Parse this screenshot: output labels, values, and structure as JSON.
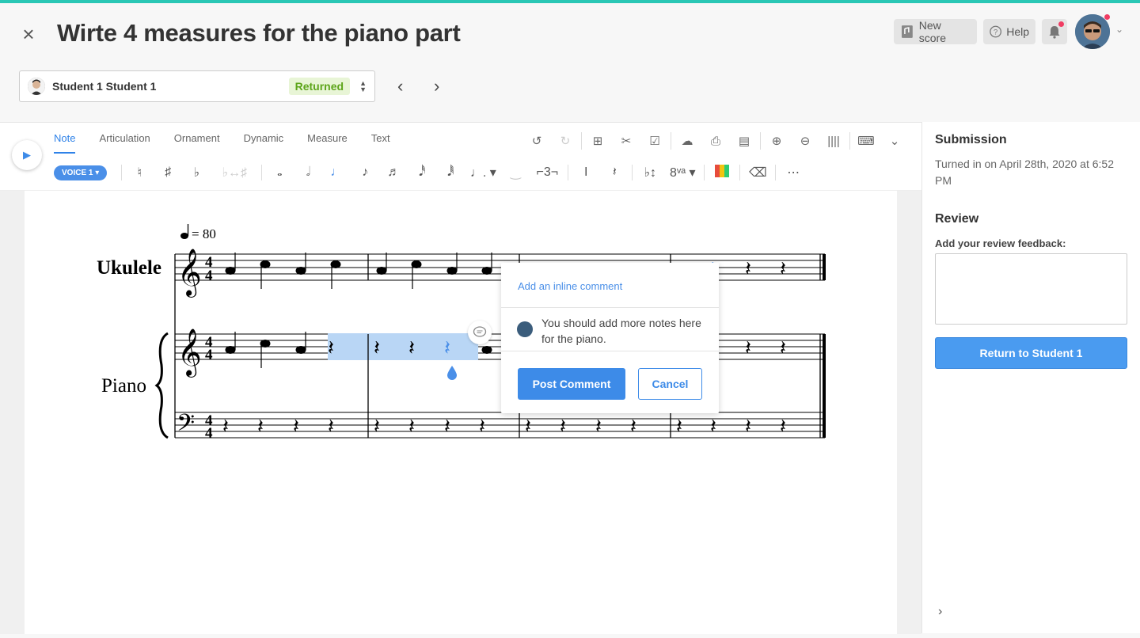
{
  "header": {
    "title": "Wirte 4 measures for the piano part",
    "new_score_label": "New score",
    "help_label": "Help"
  },
  "student": {
    "name": "Student 1 Student 1",
    "status": "Returned"
  },
  "toolbar": {
    "tabs": [
      "Note",
      "Articulation",
      "Ornament",
      "Dynamic",
      "Measure",
      "Text"
    ],
    "active_tab": "Note",
    "voice_label": "VOICE 1"
  },
  "score": {
    "tempo": "= 80",
    "instruments": [
      "Ukulele",
      "Piano"
    ]
  },
  "comment": {
    "add_label": "Add an inline comment",
    "text": "You should add more notes here for the piano.",
    "post_label": "Post Comment",
    "cancel_label": "Cancel"
  },
  "sidebar": {
    "submission_title": "Submission",
    "submission_text": "Turned in on April 28th, 2020 at 6:52 PM",
    "review_title": "Review",
    "review_label": "Add your review feedback:",
    "return_button": "Return to Student 1"
  },
  "colors": {
    "accent": "#2f82e8",
    "returned_bg": "#e8f5d6",
    "returned_text": "#5da51a",
    "top_line": "#2ac7b5"
  }
}
